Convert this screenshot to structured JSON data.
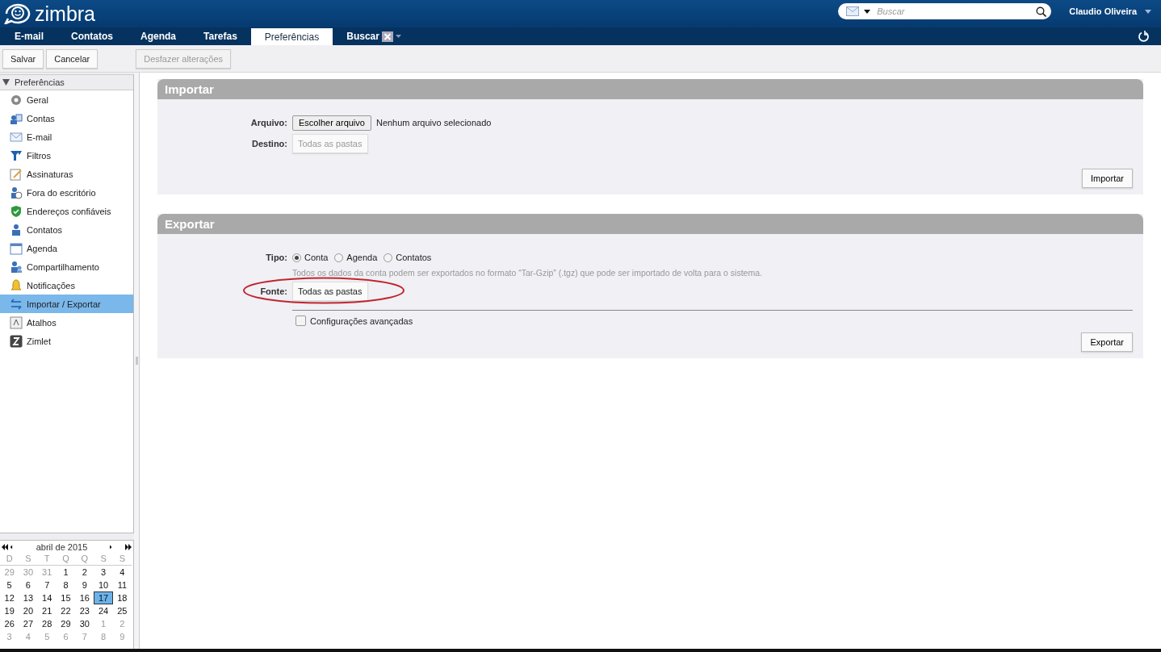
{
  "header": {
    "logo": "zimbra",
    "search": {
      "placeholder": "Buscar"
    },
    "user": "Claudio Oliveira"
  },
  "tabs": [
    {
      "label": "E-mail",
      "selected": false,
      "closable": false
    },
    {
      "label": "Contatos",
      "selected": false,
      "closable": false
    },
    {
      "label": "Agenda",
      "selected": false,
      "closable": false
    },
    {
      "label": "Tarefas",
      "selected": false,
      "closable": false
    },
    {
      "label": "Preferências",
      "selected": true,
      "closable": false
    },
    {
      "label": "Buscar",
      "selected": false,
      "closable": true
    }
  ],
  "toolbar": [
    {
      "label": "Salvar",
      "disabled": false
    },
    {
      "label": "Cancelar",
      "disabled": false
    },
    {
      "label": "Desfazer alterações",
      "disabled": true
    }
  ],
  "sidebar": {
    "title": "Preferências",
    "expanded": true,
    "items": [
      {
        "label": "Geral",
        "kind": "gear",
        "selected": false
      },
      {
        "label": "Contas",
        "kind": "accounts",
        "selected": false
      },
      {
        "label": "E-mail",
        "kind": "mail",
        "selected": false
      },
      {
        "label": "Filtros",
        "kind": "filter",
        "selected": false
      },
      {
        "label": "Assinaturas",
        "kind": "signature",
        "selected": false
      },
      {
        "label": "Fora do escritório",
        "kind": "away",
        "selected": false
      },
      {
        "label": "Endereços confiáveis",
        "kind": "shield",
        "selected": false
      },
      {
        "label": "Contatos",
        "kind": "person",
        "selected": false
      },
      {
        "label": "Agenda",
        "kind": "calendar",
        "selected": false
      },
      {
        "label": "Compartilhamento",
        "kind": "sharing",
        "selected": false
      },
      {
        "label": "Notificações",
        "kind": "bell",
        "selected": false
      },
      {
        "label": "Importar / Exportar",
        "kind": "arrows",
        "selected": true
      },
      {
        "label": "Atalhos",
        "kind": "key",
        "selected": false
      },
      {
        "label": "Zimlet",
        "kind": "zimlet",
        "selected": false
      }
    ]
  },
  "calendar": {
    "month": "abril de 2015",
    "weekdays": [
      "D",
      "S",
      "T",
      "Q",
      "Q",
      "S",
      "S"
    ],
    "weeks": [
      [
        {
          "day": "29",
          "other_month": true,
          "selected": false
        },
        {
          "day": "30",
          "other_month": true,
          "selected": false
        },
        {
          "day": "31",
          "other_month": true,
          "selected": false
        },
        {
          "day": "1",
          "other_month": false,
          "selected": false
        },
        {
          "day": "2",
          "other_month": false,
          "selected": false
        },
        {
          "day": "3",
          "other_month": false,
          "selected": false
        },
        {
          "day": "4",
          "other_month": false,
          "selected": false
        }
      ],
      [
        {
          "day": "5",
          "other_month": false,
          "selected": false
        },
        {
          "day": "6",
          "other_month": false,
          "selected": false
        },
        {
          "day": "7",
          "other_month": false,
          "selected": false
        },
        {
          "day": "8",
          "other_month": false,
          "selected": false
        },
        {
          "day": "9",
          "other_month": false,
          "selected": false
        },
        {
          "day": "10",
          "other_month": false,
          "selected": false
        },
        {
          "day": "11",
          "other_month": false,
          "selected": false
        }
      ],
      [
        {
          "day": "12",
          "other_month": false,
          "selected": false
        },
        {
          "day": "13",
          "other_month": false,
          "selected": false
        },
        {
          "day": "14",
          "other_month": false,
          "selected": false
        },
        {
          "day": "15",
          "other_month": false,
          "selected": false
        },
        {
          "day": "16",
          "other_month": false,
          "selected": false
        },
        {
          "day": "17",
          "other_month": false,
          "selected": true
        },
        {
          "day": "18",
          "other_month": false,
          "selected": false
        }
      ],
      [
        {
          "day": "19",
          "other_month": false,
          "selected": false
        },
        {
          "day": "20",
          "other_month": false,
          "selected": false
        },
        {
          "day": "21",
          "other_month": false,
          "selected": false
        },
        {
          "day": "22",
          "other_month": false,
          "selected": false
        },
        {
          "day": "23",
          "other_month": false,
          "selected": false
        },
        {
          "day": "24",
          "other_month": false,
          "selected": false
        },
        {
          "day": "25",
          "other_month": false,
          "selected": false
        }
      ],
      [
        {
          "day": "26",
          "other_month": false,
          "selected": false
        },
        {
          "day": "27",
          "other_month": false,
          "selected": false
        },
        {
          "day": "28",
          "other_month": false,
          "selected": false
        },
        {
          "day": "29",
          "other_month": false,
          "selected": false
        },
        {
          "day": "30",
          "other_month": false,
          "selected": false
        },
        {
          "day": "1",
          "other_month": true,
          "selected": false
        },
        {
          "day": "2",
          "other_month": true,
          "selected": false
        }
      ],
      [
        {
          "day": "3",
          "other_month": true,
          "selected": false
        },
        {
          "day": "4",
          "other_month": true,
          "selected": false
        },
        {
          "day": "5",
          "other_month": true,
          "selected": false
        },
        {
          "day": "6",
          "other_month": true,
          "selected": false
        },
        {
          "day": "7",
          "other_month": true,
          "selected": false
        },
        {
          "day": "8",
          "other_month": true,
          "selected": false
        },
        {
          "day": "9",
          "other_month": true,
          "selected": false
        }
      ]
    ]
  },
  "import": {
    "title": "Importar",
    "file": {
      "label": "Arquivo:",
      "button": "Escolher arquivo",
      "status": "Nenhum arquivo selecionado"
    },
    "destination": {
      "label": "Destino:",
      "value": "Todas as pastas",
      "disabled": true
    },
    "action": "Importar"
  },
  "export": {
    "title": "Exportar",
    "type": {
      "label": "Tipo:",
      "options": [
        {
          "label": "Conta",
          "selected": true
        },
        {
          "label": "Agenda",
          "selected": false
        },
        {
          "label": "Contatos",
          "selected": false
        }
      ]
    },
    "hint": "Todos os dados da conta podem ser exportados no formato “Tar-Gzip” (.tgz) que pode ser importado de volta para o sistema.",
    "source": {
      "label": "Fonte:",
      "value": "Todas as pastas",
      "disabled": false,
      "circled": true
    },
    "advanced": {
      "label": "Configurações avançadas",
      "checked": false
    },
    "action": "Exportar"
  }
}
